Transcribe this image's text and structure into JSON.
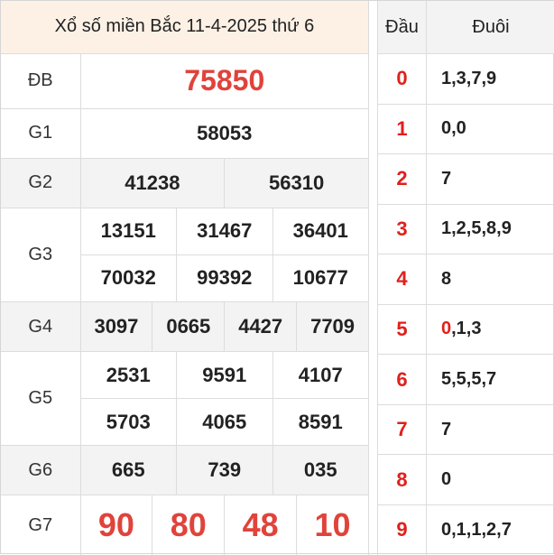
{
  "title": "Xổ số miền Bắc 11-4-2025 thứ 6",
  "prizes": {
    "db": {
      "label": "ĐB",
      "values": [
        "75850"
      ]
    },
    "g1": {
      "label": "G1",
      "values": [
        "58053"
      ]
    },
    "g2": {
      "label": "G2",
      "values": [
        "41238",
        "56310"
      ]
    },
    "g3": {
      "label": "G3",
      "values": [
        "13151",
        "31467",
        "36401",
        "70032",
        "99392",
        "10677"
      ]
    },
    "g4": {
      "label": "G4",
      "values": [
        "3097",
        "0665",
        "4427",
        "7709"
      ]
    },
    "g5": {
      "label": "G5",
      "values": [
        "2531",
        "9591",
        "4107",
        "5703",
        "4065",
        "8591"
      ]
    },
    "g6": {
      "label": "G6",
      "values": [
        "665",
        "739",
        "035"
      ]
    },
    "g7": {
      "label": "G7",
      "values": [
        "90",
        "80",
        "48",
        "10"
      ]
    }
  },
  "loto": {
    "head_label": "Đầu",
    "tail_label": "Đuôi",
    "rows": [
      {
        "dau": "0",
        "duoi_hl": "",
        "duoi": "1,3,7,9"
      },
      {
        "dau": "1",
        "duoi_hl": "",
        "duoi": "0,0"
      },
      {
        "dau": "2",
        "duoi_hl": "",
        "duoi": "7"
      },
      {
        "dau": "3",
        "duoi_hl": "",
        "duoi": "1,2,5,8,9"
      },
      {
        "dau": "4",
        "duoi_hl": "",
        "duoi": "8"
      },
      {
        "dau": "5",
        "duoi_hl": "0",
        "duoi": ",1,3"
      },
      {
        "dau": "6",
        "duoi_hl": "",
        "duoi": "5,5,5,7"
      },
      {
        "dau": "7",
        "duoi_hl": "",
        "duoi": "7"
      },
      {
        "dau": "8",
        "duoi_hl": "",
        "duoi": "0"
      },
      {
        "dau": "9",
        "duoi_hl": "",
        "duoi": "0,1,1,2,7"
      }
    ]
  },
  "colors": {
    "highlight": "#e0433b",
    "title_bg": "#fdf1e6",
    "shade": "#f3f3f3"
  }
}
